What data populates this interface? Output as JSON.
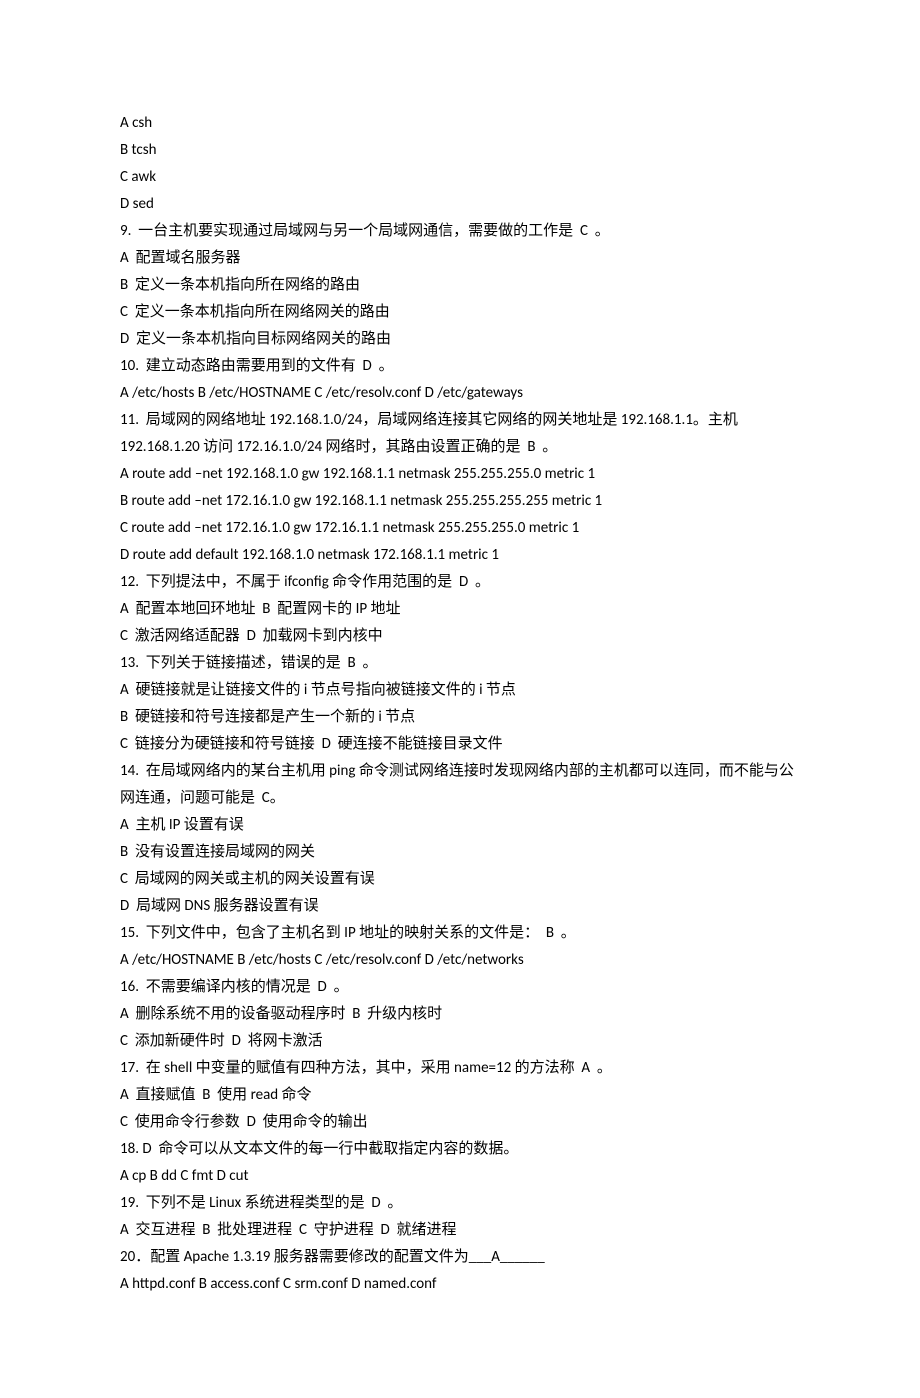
{
  "lines": [
    "A csh",
    "B tcsh",
    "C awk",
    "D sed",
    "9.  一台主机要实现通过局域网与另一个局域网通信，需要做的工作是  C  。",
    "A  配置域名服务器",
    "B  定义一条本机指向所在网络的路由",
    "C  定义一条本机指向所在网络网关的路由",
    "D  定义一条本机指向目标网络网关的路由",
    "10.  建立动态路由需要用到的文件有  D  。",
    "A /etc/hosts B /etc/HOSTNAME C /etc/resolv.conf D /etc/gateways",
    "11.  局域网的网络地址 192.168.1.0/24，局域网络连接其它网络的网关地址是 192.168.1.1。主机 192.168.1.20 访问 172.16.1.0/24 网络时，其路由设置正确的是  B  。",
    "A route add –net 192.168.1.0 gw 192.168.1.1 netmask 255.255.255.0 metric 1",
    "B route add –net 172.16.1.0 gw 192.168.1.1 netmask 255.255.255.255 metric 1",
    "C route add –net 172.16.1.0 gw 172.16.1.1 netmask 255.255.255.0 metric 1",
    "D route add default 192.168.1.0 netmask 172.168.1.1 metric 1",
    "12.  下列提法中，不属于 ifconfig 命令作用范围的是  D  。",
    "A  配置本地回环地址  B  配置网卡的 IP 地址",
    "C  激活网络适配器  D  加载网卡到内核中",
    "13.  下列关于链接描述，错误的是  B  。",
    "A  硬链接就是让链接文件的 i 节点号指向被链接文件的 i 节点",
    "B  硬链接和符号连接都是产生一个新的 i 节点",
    "C  链接分为硬链接和符号链接  D  硬连接不能链接目录文件",
    "14.  在局域网络内的某台主机用 ping 命令测试网络连接时发现网络内部的主机都可以连同，而不能与公网连通，问题可能是  C。",
    "A  主机 IP 设置有误",
    "B  没有设置连接局域网的网关",
    "C  局域网的网关或主机的网关设置有误",
    "D  局域网 DNS 服务器设置有误",
    "15.  下列文件中，包含了主机名到 IP 地址的映射关系的文件是：  B  。",
    "A /etc/HOSTNAME B /etc/hosts C /etc/resolv.conf D /etc/networks",
    "16.  不需要编译内核的情况是  D  。",
    "A  删除系统不用的设备驱动程序时  B  升级内核时",
    "C  添加新硬件时  D  将网卡激活",
    "17.  在 shell 中变量的赋值有四种方法，其中，采用 name=12 的方法称  A  。",
    "A  直接赋值  B  使用 read 命令",
    "C  使用命令行参数  D  使用命令的输出",
    "18. D  命令可以从文本文件的每一行中截取指定内容的数据。",
    "A cp B dd C fmt D cut",
    "19.  下列不是 Linux 系统进程类型的是  D  。",
    "A  交互进程  B  批处理进程  C  守护进程  D  就绪进程",
    "20．配置 Apache 1.3.19 服务器需要修改的配置文件为___A______",
    "A httpd.conf B access.conf C srm.conf D named.conf"
  ]
}
